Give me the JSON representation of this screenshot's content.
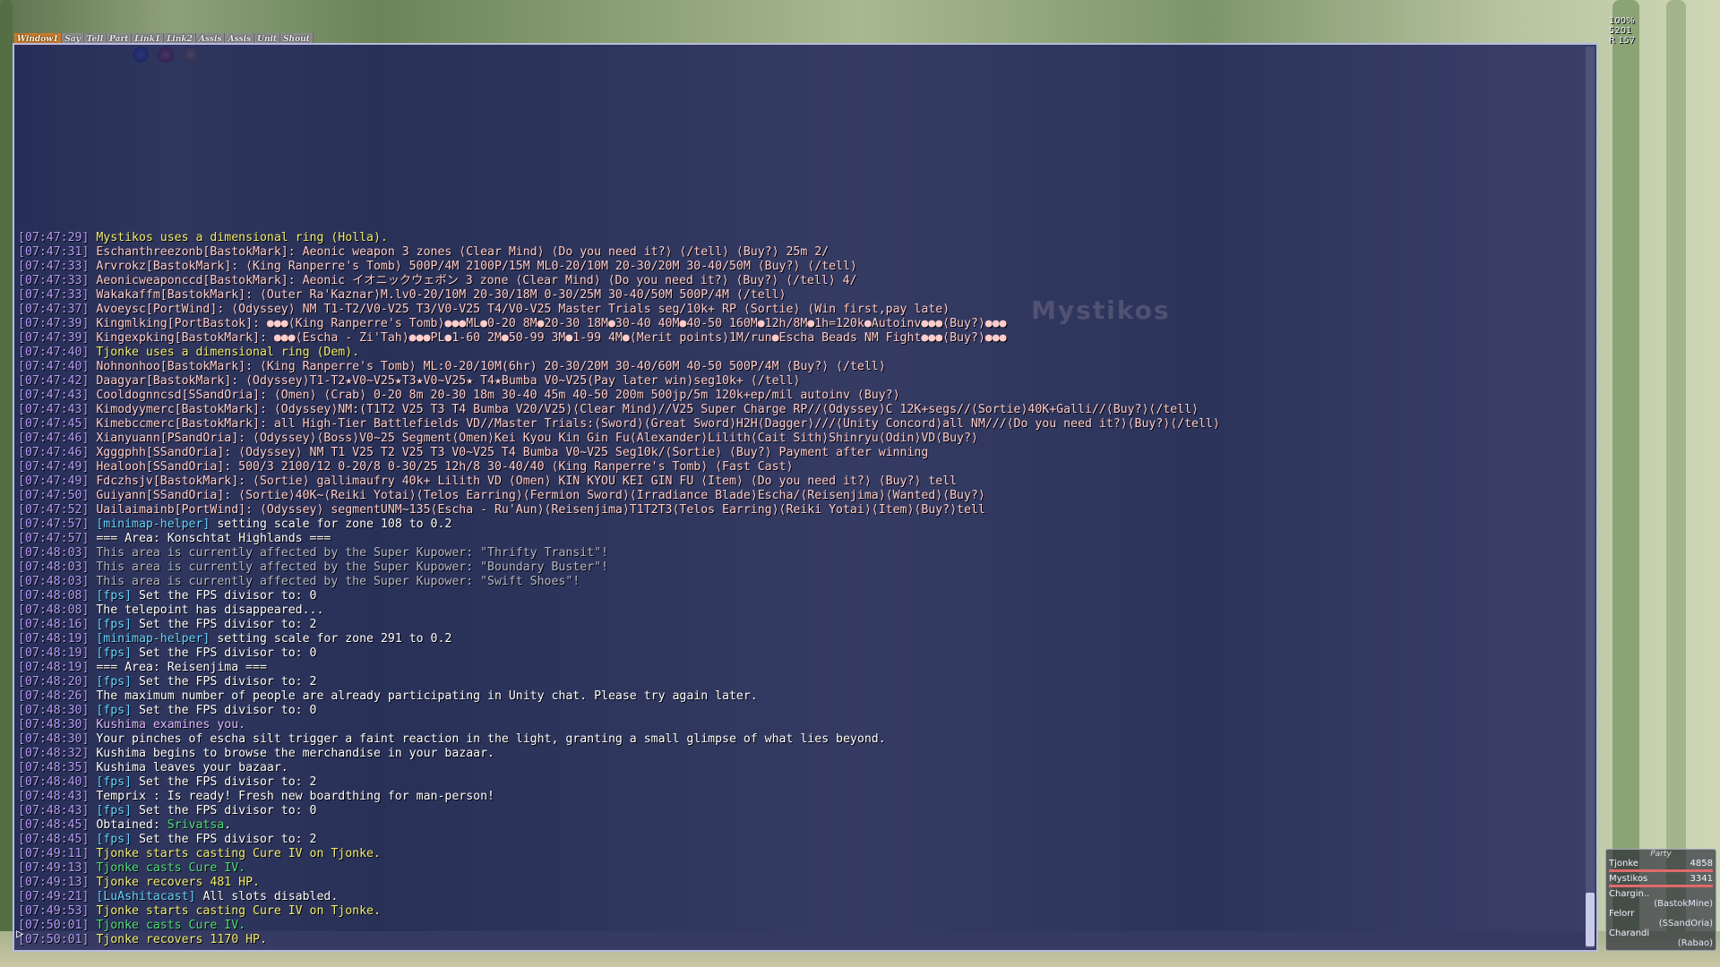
{
  "tabs": [
    "Window1",
    "Say",
    "Tell",
    "Part",
    "Link1",
    "Link2",
    "Assis",
    "Assis",
    "Unit",
    "Shout"
  ],
  "watermark": "Mystikos",
  "status": {
    "line1": "100%",
    "line2": "5201",
    "line3": "R 157"
  },
  "party": {
    "title": "Party",
    "members": [
      {
        "name": "Tjonke",
        "hp": "4858",
        "hp_pct": 100
      },
      {
        "name": "Mystikos",
        "hp": "3341",
        "hp_pct": 100
      }
    ],
    "others": [
      {
        "name": "Chargin..",
        "zone": "(BastokMine)"
      },
      {
        "name": "Felorr",
        "zone": "(SSandOria)"
      },
      {
        "name": "Charandi",
        "zone": "(Rabao)"
      }
    ]
  },
  "chat_lines": [
    {
      "ts": "[07:47:29]",
      "text": "Mystikos uses a dimensional ring (Holla).",
      "color": "y"
    },
    {
      "ts": "[07:47:31]",
      "text": "Eschanthreezonb[BastokMark]: Aeonic weapon 3 zones ⟨Clear Mind⟩ ⟨Do you need it?⟩ ⟨/tell⟩ ⟨Buy?⟩ 25m  2/",
      "color": "sh"
    },
    {
      "ts": "[07:47:33]",
      "text": "Arvrokz[BastokMark]: ⟨King Ranperre's Tomb⟩ 500P/4M 2100P/15M ML0-20/10M 20-30/20M 30-40/50M ⟨Buy?⟩ ⟨/tell⟩",
      "color": "sh"
    },
    {
      "ts": "[07:47:33]",
      "text": "Aeonicweaponccd[BastokMark]: Aeonic イオニックウェポン 3 zone ⟨Clear Mind⟩ ⟨Do you need it?⟩ ⟨Buy?⟩ ⟨/tell⟩    4/",
      "color": "sh"
    },
    {
      "ts": "[07:47:33]",
      "text": "Wakakaffm[BastokMark]: ⟨Outer Ra'Kaznar⟩M.lv0-20/10M 20-30/18M 0-30/25M 30-40/50M 500P/4M ⟨/tell⟩",
      "color": "sh"
    },
    {
      "ts": "[07:47:37]",
      "text": "Avoeysc[PortWind]: ⟨Odyssey⟩ NM T1-T2/V0-V25 T3/V0-V25 T4/V0-V25 Master Trials seg/10k+ RP ⟨Sortie⟩ (Win first,pay late)",
      "color": "sh"
    },
    {
      "ts": "[07:47:39]",
      "text": "Kingmlking[PortBastok]: ●●●⟨King Ranperre's Tomb⟩●●●ML●0-20 8M●20-30 18M●30-40 40M●40-50 160M●12h/8M●1h=120k●Autoinv●●●⟨Buy?⟩●●●",
      "color": "sh"
    },
    {
      "ts": "[07:47:39]",
      "text": "Kingexpking[BastokMark]: ●●●⟨Escha - Zi'Tah⟩●●●PL●1-60 2M●50-99 3M●1-99 4M●⟨Merit points⟩1M/run●Escha Beads NM Fight●●●⟨Buy?⟩●●●",
      "color": "sh"
    },
    {
      "ts": "[07:47:40]",
      "text": "Tjonke uses a dimensional ring (Dem).",
      "color": "y"
    },
    {
      "ts": "[07:47:40]",
      "text": "Nohnonhoo[BastokMark]: ⟨King Ranperre's Tomb⟩ ML:0-20/10M(6hr) 20-30/20M 30-40/60M 40-50 500P/4M ⟨Buy?⟩ ⟨/tell⟩",
      "color": "sh"
    },
    {
      "ts": "[07:47:42]",
      "text": "Daagyar[BastokMark]: ⟨Odyssey⟩T1-T2★V0~V25★T3★V0~V25★ T4★Bumba V0~V25(Pay later win)seg10k+ ⟨/tell⟩",
      "color": "sh"
    },
    {
      "ts": "[07:47:43]",
      "text": "Cooldognncsd[SSandOria]: ⟨Omen⟩ ⟨Crab⟩ 0-20 8m 20-30 18m 30-40 45m 40-50 200m 500jp/5m 120k+ep/mil autoinv ⟨Buy?⟩",
      "color": "sh"
    },
    {
      "ts": "[07:47:43]",
      "text": "Kimodyymerc[BastokMark]: ⟨Odyssey⟩NM:(T1T2 V25 T3 T4 Bumba V20/V25)⟨Clear Mind⟩//V25 Super Charge RP//⟨Odyssey⟩C 12K+segs//⟨Sortie⟩40K+Galli//⟨Buy?⟩⟨/tell⟩",
      "color": "sh"
    },
    {
      "ts": "[07:47:45]",
      "text": "Kimebccmerc[BastokMark]: all High-Tier Battlefields VD//Master Trials:⟨Sword⟩⟨Great Sword⟩H2H⟨Dagger⟩///⟨Unity Concord⟩all NM///⟨Do you need it?⟩⟨Buy?⟩⟨/tell⟩",
      "color": "sh"
    },
    {
      "ts": "[07:47:46]",
      "text": "Xianyuann[PSandOria]: ⟨Odyssey⟩⟨Boss⟩V0~25 Segment⟨Omen⟩Kei Kyou Kin Gin Fu⟨Alexander⟩Lilith⟨Cait Sith⟩Shinryu⟨Odin⟩VD⟨Buy?⟩",
      "color": "sh"
    },
    {
      "ts": "[07:47:46]",
      "text": "Xgggphh[SSandOria]: ⟨Odyssey⟩ NM T1 V25 T2 V25 T3 V0~V25 T4 Bumba V0~V25 Seg10k/⟨Sortie⟩ ⟨Buy?⟩ Payment after winning",
      "color": "sh"
    },
    {
      "ts": "[07:47:49]",
      "text": "Healooh[SSandOria]: 500/3 2100/12 0-20/8 0-30/25 12h/8 30-40/40 ⟨King Ranperre's Tomb⟩ ⟨Fast Cast⟩",
      "color": "sh"
    },
    {
      "ts": "[07:47:49]",
      "text": "Fdczhsjv[BastokMark]: ⟨Sortie⟩ gallimaufry 40k+ Lilith VD ⟨Omen⟩ KIN KYOU KEI GIN FU ⟨Item⟩ ⟨Do you need it?⟩ ⟨Buy?⟩ tell",
      "color": "sh"
    },
    {
      "ts": "[07:47:50]",
      "text": "Guiyann[SSandOria]: ⟨Sortie⟩40K~⟨Reiki Yotai⟩⟨Telos Earring⟩⟨Fermion Sword⟩⟨Irradiance Blade⟩Escha/⟨Reisenjima⟩⟨Wanted⟩⟨Buy?⟩",
      "color": "sh"
    },
    {
      "ts": "[07:47:52]",
      "text": "Uailaimainb[PortWind]: ⟨Odyssey⟩ segmentUNM~135⟨Escha - Ru'Aun⟩⟨Reisenjima⟩T1T2T3⟨Telos Earring⟩⟨Reiki Yotai⟩⟨Item⟩⟨Buy?⟩tell",
      "color": "sh"
    },
    {
      "ts": "[07:47:57]",
      "tag": "[minimap-helper]",
      "text": " setting scale for zone 108 to 0.2",
      "color": "w"
    },
    {
      "ts": "[07:47:57]",
      "text": "=== Area: Konschtat Highlands ===",
      "color": "w"
    },
    {
      "ts": "[07:48:03]",
      "text": "This area is currently affected by the Super Kupower: \"Thrifty Transit\"!",
      "color": "gray"
    },
    {
      "ts": "[07:48:03]",
      "text": "This area is currently affected by the Super Kupower: \"Boundary Buster\"!",
      "color": "gray"
    },
    {
      "ts": "[07:48:03]",
      "text": "This area is currently affected by the Super Kupower: \"Swift Shoes\"!",
      "color": "gray"
    },
    {
      "ts": "[07:48:08]",
      "tag": "[fps]",
      "text": " Set the FPS divisor to: 0",
      "color": "w"
    },
    {
      "ts": "[07:48:08]",
      "text": "The telepoint has disappeared...",
      "color": "w"
    },
    {
      "ts": "[07:48:16]",
      "tag": "[fps]",
      "text": " Set the FPS divisor to: 2",
      "color": "w"
    },
    {
      "ts": "[07:48:19]",
      "tag": "[minimap-helper]",
      "text": " setting scale for zone 291 to 0.2",
      "color": "w"
    },
    {
      "ts": "[07:48:19]",
      "tag": "[fps]",
      "text": " Set the FPS divisor to: 0",
      "color": "w"
    },
    {
      "ts": "[07:48:19]",
      "text": "=== Area: Reisenjima ===",
      "color": "w"
    },
    {
      "ts": "[07:48:20]",
      "tag": "[fps]",
      "text": " Set the FPS divisor to: 2",
      "color": "w"
    },
    {
      "ts": "[07:48:26]",
      "text": "The maximum number of people are already participating in Unity chat. Please try again later.",
      "color": "w"
    },
    {
      "ts": "[07:48:30]",
      "tag": "[fps]",
      "text": " Set the FPS divisor to: 0",
      "color": "w"
    },
    {
      "ts": "[07:48:30]",
      "text": "Kushima examines you.",
      "color": "v"
    },
    {
      "ts": "[07:48:30]",
      "text": "Your pinches of escha silt trigger a faint reaction in the light, granting a small glimpse of what lies beyond.",
      "color": "w"
    },
    {
      "ts": "[07:48:32]",
      "text": "Kushima begins to browse the merchandise in your bazaar.",
      "color": "w"
    },
    {
      "ts": "[07:48:35]",
      "text": "Kushima leaves your bazaar.",
      "color": "w"
    },
    {
      "ts": "[07:48:40]",
      "tag": "[fps]",
      "text": " Set the FPS divisor to: 2",
      "color": "w"
    },
    {
      "ts": "[07:48:43]",
      "text": "Temprix : Is ready! Fresh new boardthing for man-person!",
      "color": "w"
    },
    {
      "ts": "[07:48:43]",
      "tag": "[fps]",
      "text": " Set the FPS divisor to: 0",
      "color": "w"
    },
    {
      "ts": "[07:48:45]",
      "text": "Obtained: ",
      "extra": "Srivatsa",
      "tail": ".",
      "color": "w"
    },
    {
      "ts": "[07:48:45]",
      "tag": "[fps]",
      "text": " Set the FPS divisor to: 2",
      "color": "w"
    },
    {
      "ts": "[07:49:11]",
      "text": "Tjonke starts casting Cure IV on Tjonke.",
      "color": "y"
    },
    {
      "ts": "[07:49:13]",
      "text": "Tjonke casts Cure IV.",
      "color": "grn"
    },
    {
      "ts": "[07:49:13]",
      "text": "Tjonke recovers 481 HP.",
      "color": "y"
    },
    {
      "ts": "[07:49:21]",
      "tag": "[LuAshitacast]",
      "text": " All slots disabled.",
      "color": "w"
    },
    {
      "ts": "[07:49:53]",
      "text": "Tjonke starts casting Cure IV on Tjonke.",
      "color": "y"
    },
    {
      "ts": "[07:50:01]",
      "text": "Tjonke casts Cure IV.",
      "color": "grn"
    },
    {
      "ts": "[07:50:01]",
      "text": "Tjonke recovers 1170 HP.",
      "color": "y"
    }
  ]
}
